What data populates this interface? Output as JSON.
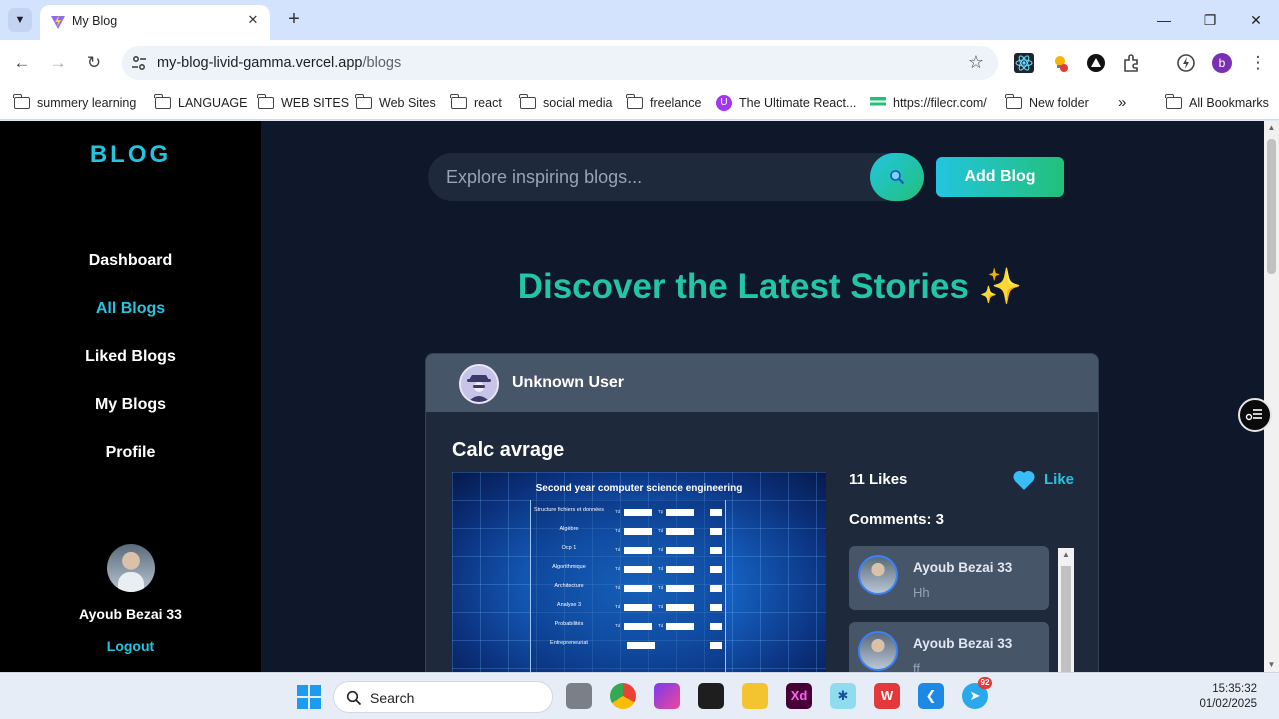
{
  "browser": {
    "tab_title": "My Blog",
    "url_host": "my-blog-livid-gamma.vercel.app",
    "url_path": "/blogs",
    "bookmarks": [
      {
        "label": "summery learning",
        "icon": "folder-icon"
      },
      {
        "label": "LANGUAGE",
        "icon": "folder-icon"
      },
      {
        "label": "WEB SITES",
        "icon": "folder-icon"
      },
      {
        "label": "Web Sites",
        "icon": "folder-icon"
      },
      {
        "label": "react",
        "icon": "folder-icon"
      },
      {
        "label": "social media",
        "icon": "folder-icon"
      },
      {
        "label": "freelance",
        "icon": "folder-icon"
      },
      {
        "label": "The Ultimate React...",
        "icon": "udemy-icon"
      },
      {
        "label": "https://filecr.com/",
        "icon": "filecr-icon"
      },
      {
        "label": "New folder",
        "icon": "folder-icon"
      }
    ],
    "all_bookmarks": "All Bookmarks",
    "profile_initial": "b"
  },
  "sidebar": {
    "brand": "BLOG",
    "items": [
      {
        "label": "Dashboard",
        "active": false
      },
      {
        "label": "All Blogs",
        "active": true
      },
      {
        "label": "Liked Blogs",
        "active": false
      },
      {
        "label": "My Blogs",
        "active": false
      },
      {
        "label": "Profile",
        "active": false
      }
    ],
    "user_name": "Ayoub Bezai 33",
    "logout": "Logout"
  },
  "search": {
    "placeholder": "Explore inspiring blogs..."
  },
  "add_blog": "Add Blog",
  "headline": "Discover the Latest Stories",
  "headline_emoji": "✨",
  "post": {
    "author": "Unknown User",
    "title": "Calc avrage",
    "image": {
      "caption": "Second year computer science engineering",
      "rows": [
        "Structure fichiers et données",
        "Algèbre",
        "Ocp 1",
        "Algorithmique",
        "Architecture",
        "Analyse 3",
        "Probabilités",
        "Entrepreneuriat"
      ]
    },
    "likes": "11 Likes",
    "like_label": "Like",
    "comments_count": "Comments: 3",
    "comments": [
      {
        "author": "Ayoub Bezai 33",
        "text": "Hh"
      },
      {
        "author": "Ayoub Bezai 33",
        "text": "ff"
      }
    ]
  },
  "taskbar": {
    "search_label": "Search",
    "time": "15:35:32",
    "date": "01/02/2025",
    "telegram_badge": "92"
  },
  "colors": {
    "accent": "#22c5e0",
    "headline": "#22c5a8",
    "page_bg": "#0f172a",
    "card_bg": "#1e293b"
  }
}
